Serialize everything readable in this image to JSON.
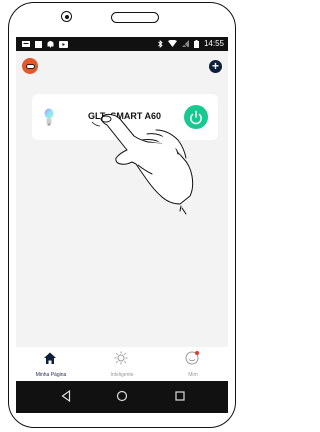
{
  "statusbar": {
    "time": "14:55"
  },
  "header": {
    "logo_icon": "robot-face-icon",
    "add_icon": "plus-icon"
  },
  "device_card": {
    "name": "GLT  SMART A60",
    "bulb_icon": "bulb-icon",
    "power_icon": "power-icon",
    "power_color": "#17c98e"
  },
  "tabs": [
    {
      "label": "Minha Página",
      "icon": "home-icon",
      "active": true
    },
    {
      "label": "Inteligente",
      "icon": "sun-icon",
      "active": false
    },
    {
      "label": "Mim",
      "icon": "profile-icon",
      "active": false
    }
  ],
  "navbar": {
    "back_icon": "back-triangle-icon",
    "home_icon": "home-circle-icon",
    "recents_icon": "recents-square-icon"
  }
}
